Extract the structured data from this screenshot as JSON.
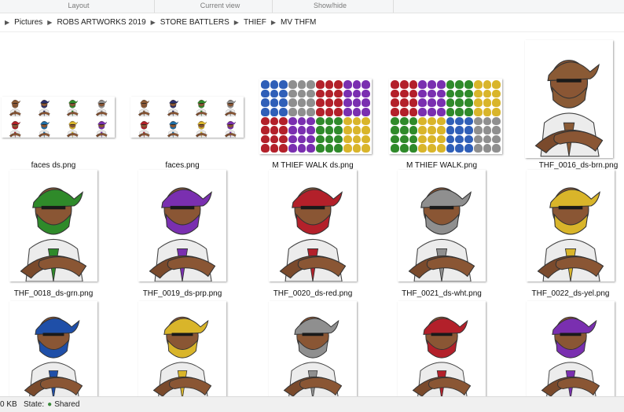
{
  "ribbon": {
    "groups": [
      "Layout",
      "Current view",
      "Show/hide"
    ]
  },
  "address": {
    "crumbs": [
      "Pictures",
      "ROBS ARTWORKS 2019",
      "STORE BATTLERS",
      "THIEF",
      "MV THFM"
    ]
  },
  "files": [
    {
      "name": "faces ds.png",
      "kind": "faces"
    },
    {
      "name": "faces.png",
      "kind": "faces"
    },
    {
      "name": "M THIEF WALK ds.png",
      "kind": "sprites"
    },
    {
      "name": "M THIEF WALK.png",
      "kind": "sprites"
    },
    {
      "name": "THF_0016_ds-brn.png",
      "kind": "portrait",
      "scarf": "#8a5a35"
    },
    {
      "name": "THF_0018_ds-grn.png",
      "kind": "portrait",
      "scarf": "#2f8a2a"
    },
    {
      "name": "THF_0019_ds-prp.png",
      "kind": "portrait",
      "scarf": "#7a2fb0"
    },
    {
      "name": "THF_0020_ds-red.png",
      "kind": "portrait",
      "scarf": "#b3202a"
    },
    {
      "name": "THF_0021_ds-wht.png",
      "kind": "portrait",
      "scarf": "#8f8f8f"
    },
    {
      "name": "THF_0022_ds-yel.png",
      "kind": "portrait",
      "scarf": "#d9b52a"
    },
    {
      "name": "",
      "kind": "portrait",
      "scarf": "#1f4fa8"
    },
    {
      "name": "",
      "kind": "portrait",
      "scarf": "#d9b52a"
    },
    {
      "name": "",
      "kind": "portrait",
      "scarf": "#8f8f8f"
    },
    {
      "name": "",
      "kind": "portrait",
      "scarf": "#b3202a"
    },
    {
      "name": "",
      "kind": "portrait",
      "scarf": "#7a2fb0"
    }
  ],
  "faceColors": [
    "#8a5a35",
    "#2b2f6a",
    "#2f8a2a",
    "#8f8f8f",
    "#b3202a",
    "#1f6fa8",
    "#d9b52a",
    "#7a2fb0"
  ],
  "spriteColors": [
    "#2f5fb8",
    "#8f8f8f",
    "#b3202a",
    "#7a2fb0",
    "#2f8a2a",
    "#d9b52a"
  ],
  "status": {
    "size": "0 KB",
    "state_label": "State:",
    "state_value": "Shared"
  }
}
